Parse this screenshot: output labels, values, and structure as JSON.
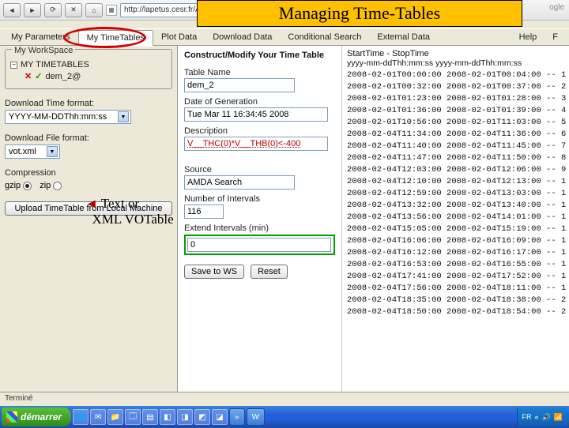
{
  "browser": {
    "url": "http://lapetus.cesr.fr/AMDA_PRETEST",
    "search_hint": "ogle"
  },
  "overlay": {
    "title": "Managing Time-Tables",
    "annotation_line1": "Text or",
    "annotation_line2": "XML VOTable"
  },
  "tabs": {
    "items": [
      {
        "label": "My Parameters"
      },
      {
        "label": "My TimeTables"
      },
      {
        "label": "Plot Data"
      },
      {
        "label": "Download Data"
      },
      {
        "label": "Conditional Search"
      },
      {
        "label": "External Data"
      }
    ],
    "help": "Help",
    "extra": "F"
  },
  "sidebar": {
    "workspace_legend": "My WorkSpace",
    "tree_root": "MY TIMETABLES",
    "tree_item": "dem_2@",
    "time_format_label": "Download Time format:",
    "time_format_value": "YYYY-MM-DDThh:mm:ss",
    "file_format_label": "Download File format:",
    "file_format_value": "vot.xml",
    "compression_label": "Compression",
    "gzip": "gzip",
    "zip": "zip",
    "upload_btn": "Upload TimeTable from Local Machine"
  },
  "form": {
    "heading": "Construct/Modify Your Time Table",
    "name_label": "Table Name",
    "name_value": "dem_2",
    "date_label": "Date of Generation",
    "date_value": "Tue Mar 11 16:34:45 2008",
    "desc_label": "Description",
    "desc_value": "V__THC(0)*V__THB(0)<-400",
    "source_label": "Source",
    "source_value": "AMDA Search",
    "nint_label": "Number of Intervals",
    "nint_value": "116",
    "extend_label": "Extend Intervals (min)",
    "extend_value": "0",
    "save_btn": "Save to WS",
    "reset_btn": "Reset"
  },
  "timelist": {
    "head": "StartTime - StopTime",
    "sub": "yyyy-mm-ddThh:mm:ss yyyy-mm-ddThh:mm:ss",
    "rows": [
      "2008-02-01T00:00:00 2008-02-01T00:04:00 -- 1",
      "2008-02-01T00:32:00 2008-02-01T00:37:00 -- 2",
      "2008-02-01T01:23:00 2008-02-01T01:28:00 -- 3",
      "2008-02-01T01:36:00 2008-02-01T01:39:00 -- 4",
      "2008-02-01T10:56:00 2008-02-01T11:03:00 -- 5",
      "2008-02-04T11:34:00 2008-02-04T11:36:00 -- 6",
      "2008-02-04T11:40:00 2008-02-04T11:45:00 -- 7",
      "2008-02-04T11:47:00 2008-02-04T11:50:00 -- 8",
      "2008-02-04T12:03:00 2008-02-04T12:06:00 -- 9",
      "2008-02-04T12:10:00 2008-02-04T12:13:00 -- 1",
      "2008-02-04T12:59:00 2008-02-04T13:03:00 -- 1",
      "2008-02-04T13:32:00 2008-02-04T13:40:00 -- 1",
      "2008-02-04T13:56:00 2008-02-04T14:01:00 -- 1",
      "2008-02-04T15:05:00 2008-02-04T15:19:00 -- 1",
      "2008-02-04T16:06:00 2008-02-04T16:09:00 -- 1",
      "2008-02-04T16:12:00 2008-02-04T16:17:00 -- 1",
      "2008-02-04T16:53:00 2008-02-04T16:55:00 -- 1",
      "2008-02-04T17:41:00 2008-02-04T17:52:00 -- 1",
      "2008-02-04T17:56:00 2008-02-04T18:11:00 -- 1",
      "2008-02-04T18:35:00 2008-02-04T18:38:00 -- 2",
      "2008-02-04T18:50:00 2008-02-04T18:54:00 -- 2"
    ]
  },
  "status": {
    "text": "Terminé"
  },
  "taskbar": {
    "start": "démarrer",
    "tab_w": "W",
    "arrows": "»",
    "tray_lang": "FR",
    "tray_net": "«",
    "tray_vol": "🔊",
    "tray_sig": "📶"
  }
}
